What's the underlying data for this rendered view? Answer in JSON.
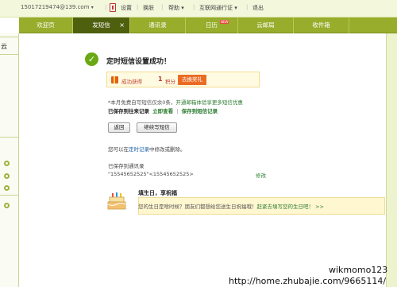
{
  "topbar": {
    "account": "15017219474@139.com",
    "items": [
      "设置",
      "换肤",
      "帮助",
      "互联网通行证",
      "退出"
    ]
  },
  "tabs": [
    {
      "label": "欢迎页"
    },
    {
      "label": "发短信",
      "close": "×"
    },
    {
      "label": "通讯录"
    },
    {
      "label": "日历",
      "badge": "NEW"
    },
    {
      "label": "云邮局"
    },
    {
      "label": "收件箱"
    }
  ],
  "leftnav": {
    "label1": "箱",
    "label2": "云"
  },
  "success": {
    "title": "定时短信设置成功！",
    "reward_text": "成功获得",
    "reward_num": "1",
    "reward_unit": "积分",
    "reward_btn": "去换奖礼",
    "line1_a": "*本月免费自写短信仅余0条，",
    "line1_b": "开通邮箱体验享更多短信优惠",
    "line2_a": "已保存到往来记录",
    "line2_b": "立即查看",
    "line2_sep": "|",
    "line2_c": "保存到短信记录"
  },
  "buttons": {
    "back": "返回",
    "continue": "继续写短信"
  },
  "info": {
    "line_a": "您可以在",
    "line_link": "定时记录",
    "line_b": "中修改或删除。",
    "saved_label": "已保存到通讯录",
    "contact": "\"15545652525\"<15545652525>",
    "modify": "修改"
  },
  "birthday": {
    "title": "填生日，享祝福",
    "text_a": "您的生日是啥时候？朋友们都想给您送生日祝福哦！",
    "text_link": "赶紧去填写您的生日吧！",
    "more": ">>"
  },
  "watermark": {
    "line1": "wikmomo123",
    "line2": "http://home.zhubajie.com/9665114/"
  },
  "colors": {
    "tabbar": "#97ad2b",
    "active_tab": "#4e5f0e",
    "success": "#6aa814",
    "reward_btn": "#ea6c24"
  }
}
